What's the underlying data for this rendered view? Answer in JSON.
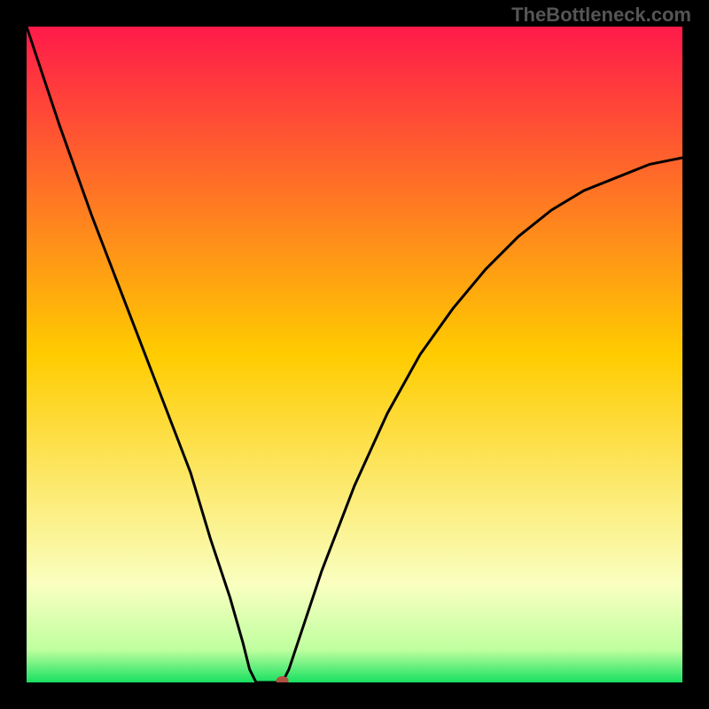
{
  "attribution": "TheBottleneck.com",
  "chart_data": {
    "type": "line",
    "title": "",
    "xlabel": "",
    "ylabel": "",
    "xlim": [
      0,
      100
    ],
    "ylim": [
      0,
      100
    ],
    "gradient_stops": [
      {
        "offset": 0,
        "color": "#ff1a4a"
      },
      {
        "offset": 50,
        "color": "#ffcc00"
      },
      {
        "offset": 85,
        "color": "#faffc0"
      },
      {
        "offset": 95,
        "color": "#c0ffa0"
      },
      {
        "offset": 100,
        "color": "#18e060"
      }
    ],
    "series": [
      {
        "name": "bottleneck-curve",
        "points": [
          {
            "x": 0,
            "y": 100
          },
          {
            "x": 5,
            "y": 85
          },
          {
            "x": 10,
            "y": 71
          },
          {
            "x": 15,
            "y": 58
          },
          {
            "x": 20,
            "y": 45
          },
          {
            "x": 25,
            "y": 32
          },
          {
            "x": 28,
            "y": 22
          },
          {
            "x": 31,
            "y": 13
          },
          {
            "x": 33,
            "y": 6
          },
          {
            "x": 34,
            "y": 2
          },
          {
            "x": 35,
            "y": 0
          },
          {
            "x": 39,
            "y": 0
          },
          {
            "x": 40,
            "y": 2
          },
          {
            "x": 42,
            "y": 8
          },
          {
            "x": 45,
            "y": 17
          },
          {
            "x": 50,
            "y": 30
          },
          {
            "x": 55,
            "y": 41
          },
          {
            "x": 60,
            "y": 50
          },
          {
            "x": 65,
            "y": 57
          },
          {
            "x": 70,
            "y": 63
          },
          {
            "x": 75,
            "y": 68
          },
          {
            "x": 80,
            "y": 72
          },
          {
            "x": 85,
            "y": 75
          },
          {
            "x": 90,
            "y": 77
          },
          {
            "x": 95,
            "y": 79
          },
          {
            "x": 100,
            "y": 80
          }
        ]
      }
    ],
    "marker": {
      "x": 39,
      "y": 0,
      "color": "#b05040"
    }
  }
}
